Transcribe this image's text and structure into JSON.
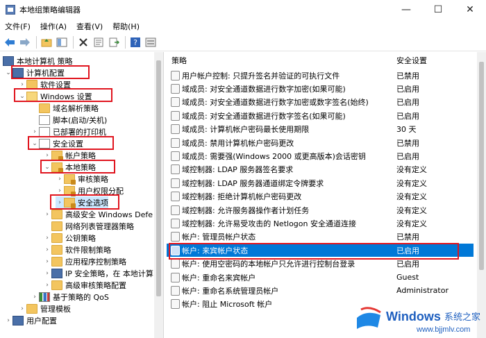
{
  "window": {
    "title": "本地组策略编辑器",
    "controls": [
      "—",
      "☐",
      "✕"
    ]
  },
  "menu": [
    "文件(F)",
    "操作(A)",
    "查看(V)",
    "帮助(H)"
  ],
  "toolbar": {
    "icons": [
      "back-arrow-icon",
      "forward-arrow-icon",
      "folder-up-icon",
      "show-tree-icon",
      "delete-icon",
      "properties-icon",
      "export-list-icon",
      "help-icon",
      "view-icon"
    ]
  },
  "tree": [
    {
      "label": "本地计算机 策略"
    },
    {
      "label": "计算机配置"
    },
    {
      "label": "软件设置"
    },
    {
      "label": "Windows 设置"
    },
    {
      "label": "域名解析策略"
    },
    {
      "label": "脚本(启动/关机)"
    },
    {
      "label": "已部署的打印机"
    },
    {
      "label": "安全设置"
    },
    {
      "label": "帐户策略"
    },
    {
      "label": "本地策略"
    },
    {
      "label": "审核策略"
    },
    {
      "label": "用户权限分配"
    },
    {
      "label": "安全选项"
    },
    {
      "label": "高级安全 Windows Defe"
    },
    {
      "label": "网络列表管理器策略"
    },
    {
      "label": "公钥策略"
    },
    {
      "label": "软件限制策略"
    },
    {
      "label": "应用程序控制策略"
    },
    {
      "label": "IP 安全策略，在 本地计算"
    },
    {
      "label": "高级审核策略配置"
    },
    {
      "label": "基于策略的 QoS"
    },
    {
      "label": "管理模板"
    },
    {
      "label": "用户配置"
    }
  ],
  "columns": {
    "policy": "策略",
    "setting": "安全设置"
  },
  "policies": [
    {
      "name": "用户帐户控制: 只提升签名并验证的可执行文件",
      "value": "已禁用"
    },
    {
      "name": "域成员: 对安全通道数据进行数字加密(如果可能)",
      "value": "已启用"
    },
    {
      "name": "域成员: 对安全通道数据进行数字加密或数字签名(始终)",
      "value": "已启用"
    },
    {
      "name": "域成员: 对安全通道数据进行数字签名(如果可能)",
      "value": "已启用"
    },
    {
      "name": "域成员: 计算机帐户密码最长使用期限",
      "value": "30 天"
    },
    {
      "name": "域成员: 禁用计算机帐户密码更改",
      "value": "已禁用"
    },
    {
      "name": "域成员: 需要强(Windows 2000 或更高版本)会话密钥",
      "value": "已启用"
    },
    {
      "name": "域控制器: LDAP 服务器签名要求",
      "value": "没有定义"
    },
    {
      "name": "域控制器: LDAP 服务器通道绑定令牌要求",
      "value": "没有定义"
    },
    {
      "name": "域控制器: 拒绝计算机帐户密码更改",
      "value": "没有定义"
    },
    {
      "name": "域控制器: 允许服务器操作者计划任务",
      "value": "没有定义"
    },
    {
      "name": "域控制器:  允许易受攻击的 Netlogon 安全通道连接",
      "value": "没有定义"
    },
    {
      "name": "帐户: 管理员帐户状态",
      "value": "已禁用"
    },
    {
      "name": "帐户: 来宾帐户状态",
      "value": "已启用"
    },
    {
      "name": "帐户: 使用空密码的本地帐户只允许进行控制台登录",
      "value": "已启用"
    },
    {
      "name": "帐户: 重命名来宾帐户",
      "value": "Guest"
    },
    {
      "name": "帐户: 重命名系统管理员帐户",
      "value": "Administrator"
    },
    {
      "name": "帐户: 阻止 Microsoft 帐户",
      "value": ""
    }
  ],
  "watermark": {
    "brand": "Windows",
    "suffix": "系统之家",
    "url": "www.bjjmlv.com"
  },
  "colors": {
    "selection": "#0078d7",
    "highlight_box": "#e0141e"
  }
}
